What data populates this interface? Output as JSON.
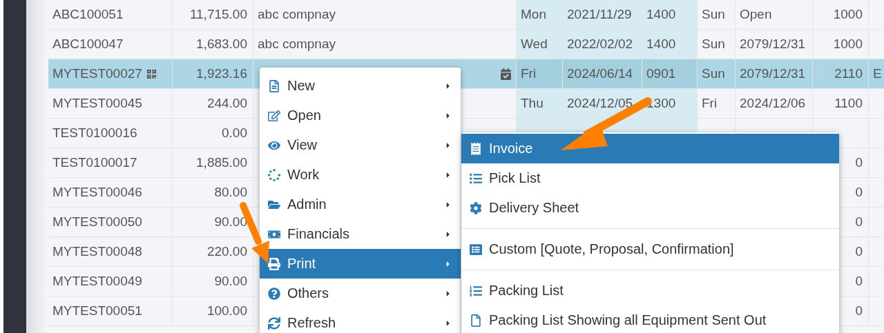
{
  "table": {
    "rows": [
      {
        "selected": false,
        "marked": false,
        "column_1": "ABC100051",
        "column_2": "11,715.00",
        "column_3": "abc compnay",
        "column_4": "Mon",
        "column_5": "2021/11/29",
        "column_6": "1400",
        "column_7": "Sun",
        "column_8": "Open",
        "column_9": "1000"
      },
      {
        "selected": false,
        "marked": false,
        "column_1": "ABC100047",
        "column_2": "1,683.00",
        "column_3": "abc compnay",
        "column_4": "Wed",
        "column_5": "2022/02/02",
        "column_6": "1400",
        "column_7": "Sun",
        "column_8": "2079/12/31",
        "column_9": "1000"
      },
      {
        "selected": true,
        "marked": true,
        "column_1": "MYTEST00027",
        "column_2": "1,923.16",
        "column_4": "Fri",
        "column_5": "2024/06/14",
        "column_6": "0901",
        "column_7": "Sun",
        "column_8": "2079/12/31",
        "column_9": "2110",
        "column_10": "E"
      },
      {
        "selected": false,
        "marked": false,
        "column_1": "MYTEST00045",
        "column_2": "244.00",
        "column_4": "Thu",
        "column_5": "2024/12/05",
        "column_6": "1300",
        "column_7": "Fri",
        "column_8": "2024/12/06",
        "column_9": "1100"
      },
      {
        "selected": false,
        "marked": false,
        "column_1": "TEST0100016",
        "column_2": "0.00"
      },
      {
        "selected": false,
        "marked": false,
        "column_1": "TEST0100017",
        "column_2": "1,885.00",
        "column_9": "0"
      },
      {
        "selected": false,
        "marked": false,
        "column_1": "MYTEST00046",
        "column_2": "80.00",
        "column_9": "0"
      },
      {
        "selected": false,
        "marked": false,
        "column_1": "MYTEST00050",
        "column_2": "90.00",
        "column_9": "0"
      },
      {
        "selected": false,
        "marked": false,
        "column_1": "MYTEST00048",
        "column_2": "220.00",
        "column_9": "0"
      },
      {
        "selected": false,
        "marked": false,
        "column_1": "MYTEST00049",
        "column_2": "90.00",
        "column_9": "0"
      },
      {
        "selected": false,
        "marked": false,
        "column_1": "MYTEST00051",
        "column_2": "100.00",
        "column_9": "0"
      }
    ]
  },
  "context_menu": {
    "items": [
      {
        "label": "New",
        "selected": false
      },
      {
        "label": "Open",
        "selected": false
      },
      {
        "label": "View",
        "selected": false
      },
      {
        "label": "Work",
        "selected": false
      },
      {
        "label": "Admin",
        "selected": false
      },
      {
        "label": "Financials",
        "selected": false
      },
      {
        "label": "Print",
        "selected": true
      },
      {
        "label": "Others",
        "selected": false
      },
      {
        "label": "Refresh",
        "selected": false
      }
    ]
  },
  "submenu": {
    "items": [
      {
        "label": "Invoice",
        "selected": true,
        "divider_before": false
      },
      {
        "label": "Pick List",
        "selected": false,
        "divider_before": false
      },
      {
        "label": "Delivery Sheet",
        "selected": false,
        "divider_before": false
      },
      {
        "label": "Custom [Quote, Proposal, Confirmation]",
        "selected": false,
        "divider_before": true
      },
      {
        "label": "Packing List",
        "selected": false,
        "divider_before": true
      },
      {
        "label": "Packing List Showing all Equipment Sent Out",
        "selected": false,
        "divider_before": false
      }
    ]
  }
}
